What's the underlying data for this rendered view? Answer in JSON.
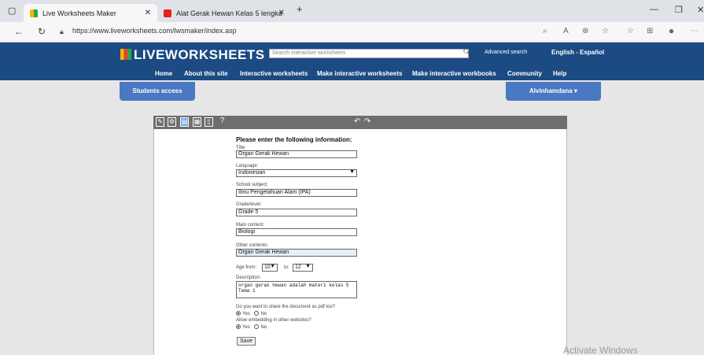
{
  "browser": {
    "tabs": [
      {
        "title": "Live Worksheets Maker"
      },
      {
        "title": "Alat Gerak Hewan Kelas 5 lengka"
      }
    ],
    "new_tab": "+",
    "url": "https://www.liveworksheets.com/lwsmaker/index.asp",
    "colors": {
      "tabbar": "#dfe3e8",
      "youtube": "#e62117"
    }
  },
  "site": {
    "logo": "LIVEWORKSHEETS",
    "search_placeholder": "Search interactive worksheets",
    "advanced_search": "Advanced search",
    "languages": "English - Español",
    "menu": [
      "Home",
      "About this site",
      "Interactive worksheets",
      "Make interactive worksheets",
      "Make interactive workbooks",
      "Community",
      "Help"
    ],
    "students_access": "Students access",
    "user": "Alvinhamdana ▾",
    "colors": {
      "header": "#1c4b84",
      "button": "#4a78c2"
    }
  },
  "form": {
    "heading": "Please enter the following information:",
    "title_label": "Title:",
    "title_value": "Organ Gerak Hewan",
    "language_label": "Language:",
    "language_value": "Indonesian",
    "subject_label": "School subject:",
    "subject_value": "Ilmu Pengetahuan Alam (IPA)",
    "grade_label": "Grade/level:",
    "grade_value": "Grade 5",
    "main_label": "Main content:",
    "main_value": "Biologi",
    "other_label": "Other contents:",
    "other_value": "Organ Gerak Hewan",
    "age_from_label": "Age from:",
    "age_from": "10",
    "age_to_label": "to:",
    "age_to": "12",
    "desc_label": "Description:",
    "desc_value": "organ gerak hewan adalah materi kelas 5 Tema 1",
    "pdf_question": "Do you want to share the document as pdf too?",
    "embed_question": "Allow embedding in other websites?",
    "yes": "Yes",
    "no": "No",
    "save": "Save"
  },
  "watermark": "Activate Windows"
}
